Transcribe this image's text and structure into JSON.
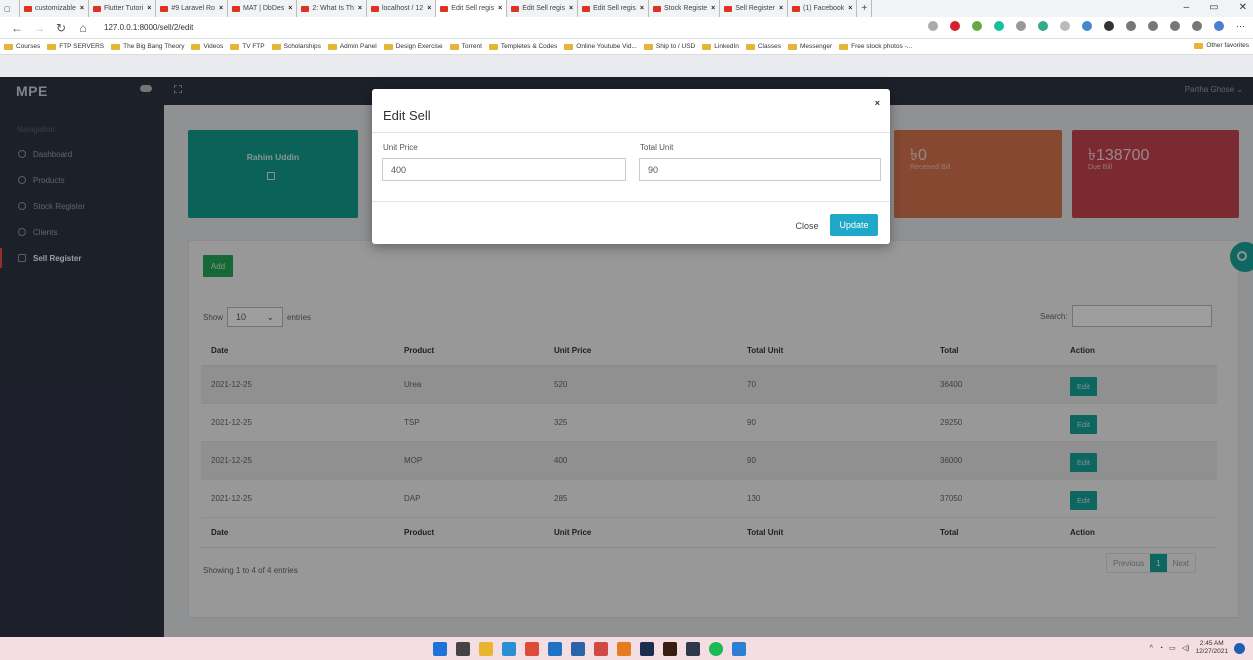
{
  "browser": {
    "tabs": [
      {
        "label": "customizable",
        "active": false
      },
      {
        "label": "Flutter Tutori",
        "active": false
      },
      {
        "label": "#9 Laravel Ro",
        "active": false
      },
      {
        "label": "MAT | DbDes",
        "active": false
      },
      {
        "label": "2: What Is Th",
        "active": false
      },
      {
        "label": "localhost / 12",
        "active": false
      },
      {
        "label": "Edit Sell regis",
        "active": true
      },
      {
        "label": "Edit Sell regis",
        "active": false
      },
      {
        "label": "Edit Sell regis",
        "active": false
      },
      {
        "label": "Stock Registe",
        "active": false
      },
      {
        "label": "Sell Register",
        "active": false
      },
      {
        "label": "(1) Facebook",
        "active": false
      }
    ],
    "url": "127.0.0.1:8000/sell/2/edit",
    "bookmarks": [
      "Courses",
      "FTP SERVERS",
      "The Big Bang Theory",
      "Videos",
      "TV FTP",
      "Scholarships",
      "Admin Panel",
      "Design Exercise",
      "Torrent",
      "Templetes & Codes",
      "Online Youtube Vid...",
      "Ship to / USD",
      "LinkedIn",
      "Classes",
      "Messenger",
      "Free stock photos -..."
    ],
    "other_favorites": "Other favorites"
  },
  "app": {
    "logo": "MPE",
    "user": "Partha Ghose",
    "nav_heading": "Navigation",
    "nav": [
      "Dashboard",
      "Products",
      "Stock Register",
      "Clients",
      "Sell Register"
    ],
    "active_nav": "Sell Register"
  },
  "cards": {
    "client_name": "Rahim Uddin",
    "received_value": "৳0",
    "received_label": "Received Bill",
    "due_value": "৳138700",
    "due_label": "Due Bill"
  },
  "table": {
    "add_label": "Add",
    "show_label": "Show",
    "entries_value": "10",
    "entries_label": "entries",
    "search_label": "Search:",
    "columns": [
      "Date",
      "Product",
      "Unit Price",
      "Total Unit",
      "Total",
      "Action"
    ],
    "rows": [
      {
        "date": "2021-12-25",
        "product": "Urea",
        "unit_price": "520",
        "total_unit": "70",
        "total": "36400",
        "action": "Edit"
      },
      {
        "date": "2021-12-25",
        "product": "TSP",
        "unit_price": "325",
        "total_unit": "90",
        "total": "29250",
        "action": "Edit"
      },
      {
        "date": "2021-12-25",
        "product": "MOP",
        "unit_price": "400",
        "total_unit": "90",
        "total": "36000",
        "action": "Edit"
      },
      {
        "date": "2021-12-25",
        "product": "DAP",
        "unit_price": "285",
        "total_unit": "130",
        "total": "37050",
        "action": "Edit"
      }
    ],
    "info": "Showing 1 to 4 of 4 entries",
    "pager": {
      "previous": "Previous",
      "current": "1",
      "next": "Next"
    }
  },
  "modal": {
    "title": "Edit Sell",
    "close_x": "×",
    "unit_price_label": "Unit Price",
    "unit_price_value": "400",
    "total_unit_label": "Total Unit",
    "total_unit_value": "90",
    "close_label": "Close",
    "update_label": "Update"
  },
  "taskbar": {
    "time": "2:45 AM",
    "date": "12/27/2021"
  },
  "colors": {
    "sidebar": "#2e3443",
    "teal": "#139e8f",
    "orange": "#d8744f",
    "red": "#c8444f",
    "update_button": "#1fa8c7",
    "add_button": "#25a95a"
  }
}
